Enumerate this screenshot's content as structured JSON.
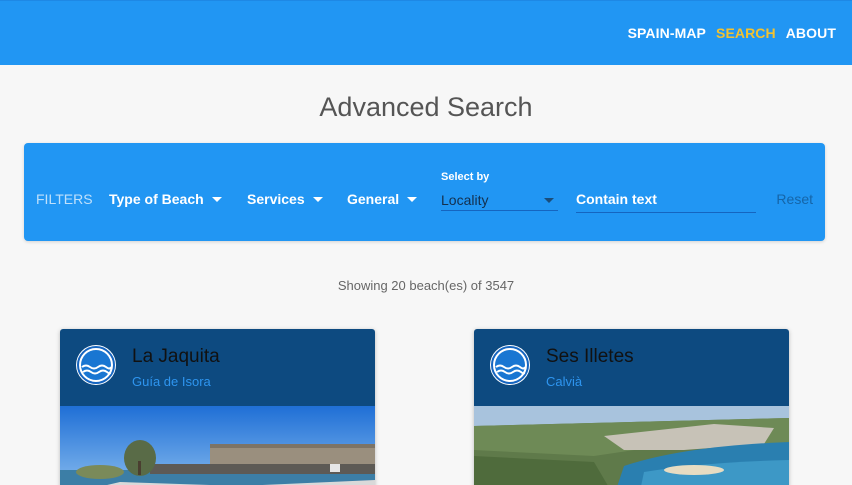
{
  "nav": {
    "items": [
      {
        "label": "SPAIN-MAP",
        "active": false
      },
      {
        "label": "SEARCH",
        "active": true
      },
      {
        "label": "ABOUT",
        "active": false
      }
    ]
  },
  "page": {
    "title": "Advanced Search"
  },
  "filters": {
    "label": "FILTERS",
    "type_of_beach": "Type of Beach",
    "services": "Services",
    "general": "General",
    "select_by_label": "Select by",
    "select_by_value": "Locality",
    "contain_text_placeholder": "Contain text",
    "reset": "Reset"
  },
  "results": {
    "count_text": "Showing 20 beach(es) of 3547"
  },
  "beaches": [
    {
      "name": "La Jaquita",
      "locality": "Guía de Isora"
    },
    {
      "name": "Ses Illetes",
      "locality": "Calvià"
    }
  ],
  "colors": {
    "header": "#2196f3",
    "active_nav": "#f2c230",
    "card_header": "#0d4a80",
    "locality": "#2e95ef"
  }
}
